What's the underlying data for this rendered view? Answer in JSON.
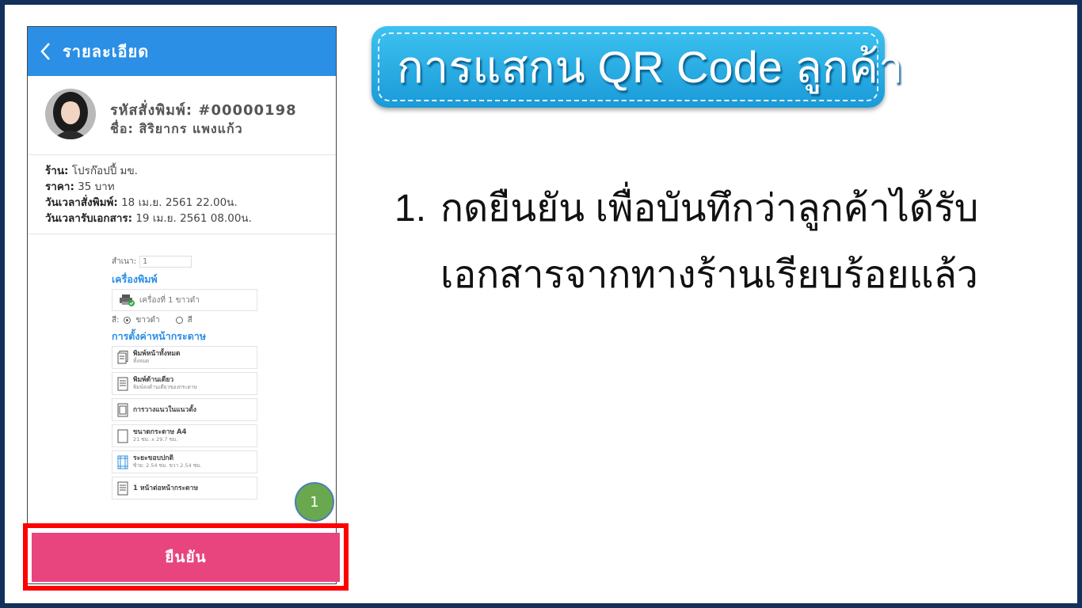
{
  "phone": {
    "header_title": "รายละเอียด",
    "order_code": "รหัสสั่งพิมพ์: #00000198",
    "customer_name": "ชื่อ: สิริยากร แพงแก้ว",
    "info": {
      "shop_label": "ร้าน:",
      "shop_value": "โปรก๊อปปี้ มข.",
      "price_label": "ราคา:",
      "price_value": "35 บาท",
      "order_time_label": "วันเวลาสั่งพิมพ์:",
      "order_time_value": "18 เม.ย. 2561 22.00น.",
      "pickup_time_label": "วันเวลารับเอกสาร:",
      "pickup_time_value": "19 เม.ย. 2561 08.00น."
    },
    "settings": {
      "copies_label": "สำเนา:",
      "copies_value": "1",
      "printer_section": "เครื่องพิมพ์",
      "printer_value": "เครื่องที่ 1 ขาวดำ",
      "color_label": "สี:",
      "color_options": [
        "ขาวดำ",
        "สี"
      ],
      "page_section": "การตั้งค่าหน้ากระดาษ",
      "options": [
        {
          "main": "พิมพ์หน้าทั้งหมด",
          "sub": "ทั้งหมด"
        },
        {
          "main": "พิมพ์ด้านเดียว",
          "sub": "พิมพ์ลงด้านเดียวของกระดาษ"
        },
        {
          "main": "การวางแนวในแนวตั้ง",
          "sub": ""
        },
        {
          "main": "ขนาดกระดาษ A4",
          "sub": "21 ซม. x 29.7 ซม."
        },
        {
          "main": "ระยะขอบปกติ",
          "sub": "ซ้าย: 2.54 ซม.     ขวา 2.54 ซม."
        },
        {
          "main": "1 หน้าต่อหน้ากระดาษ",
          "sub": ""
        }
      ]
    },
    "confirm_label": "ยืนยัน"
  },
  "step_badge": "1",
  "banner_title": "การแสกน QR Code ลูกค้า",
  "instruction": {
    "number": "1.",
    "line1": "กดยืนยัน เพื่อบันทึกว่าลูกค้าได้รับ",
    "line2": "เอกสารจากทางร้านเรียบร้อยแล้ว"
  },
  "colors": {
    "header_blue": "#2b8fe6",
    "confirm_pink": "#e8457e",
    "highlight_red": "#ff0000",
    "badge_green": "#6aa84f",
    "banner_blue": "#1a9ad8"
  }
}
